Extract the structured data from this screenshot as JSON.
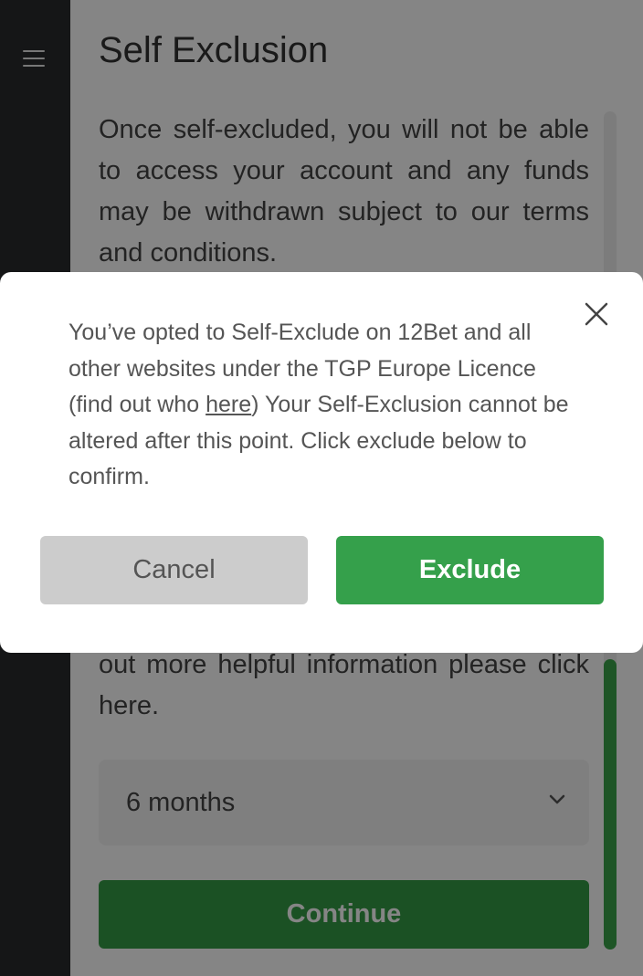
{
  "sidebar": {
    "menu_icon": "hamburger-menu-icon"
  },
  "page": {
    "title": "Self Exclusion",
    "intro": "Once self-excluded, you will not be able to access your account and any funds may be withdrawn subject to our terms and conditions.",
    "info_tail": "out more helpful information please click here.",
    "period_select": {
      "value": "6 months",
      "icon": "chevron-down-icon"
    },
    "continue_label": "Continue"
  },
  "modal": {
    "close_icon": "close-icon",
    "message_part1": "You’ve opted to Self-Exclude on 12Bet and all other websites under the TGP Europe Licence (find out who ",
    "message_link": "here",
    "message_part2": ") Your Self-Exclusion cannot be altered after this point. Click exclude below to confirm.",
    "cancel_label": "Cancel",
    "exclude_label": "Exclude"
  },
  "colors": {
    "accent_green": "#35a04b",
    "sidebar_bg": "#2a2b2d",
    "overlay": "rgba(0,0,0,0.48)"
  }
}
